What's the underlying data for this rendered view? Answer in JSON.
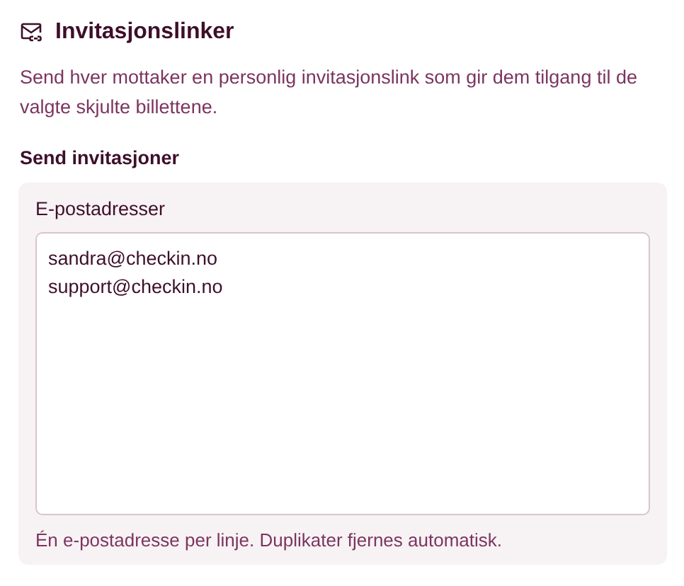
{
  "section": {
    "title": "Invitasjonslinker",
    "description": "Send hver mottaker en personlig invitasjonslink som gir dem tilgang til de valgte skjulte billettene.",
    "subheading": "Send invitasjoner",
    "card": {
      "label": "E-postadresser",
      "value": "sandra@checkin.no\nsupport@checkin.no",
      "hint": "Én e-postadresse per linje. Duplikater fjernes automatisk."
    }
  }
}
